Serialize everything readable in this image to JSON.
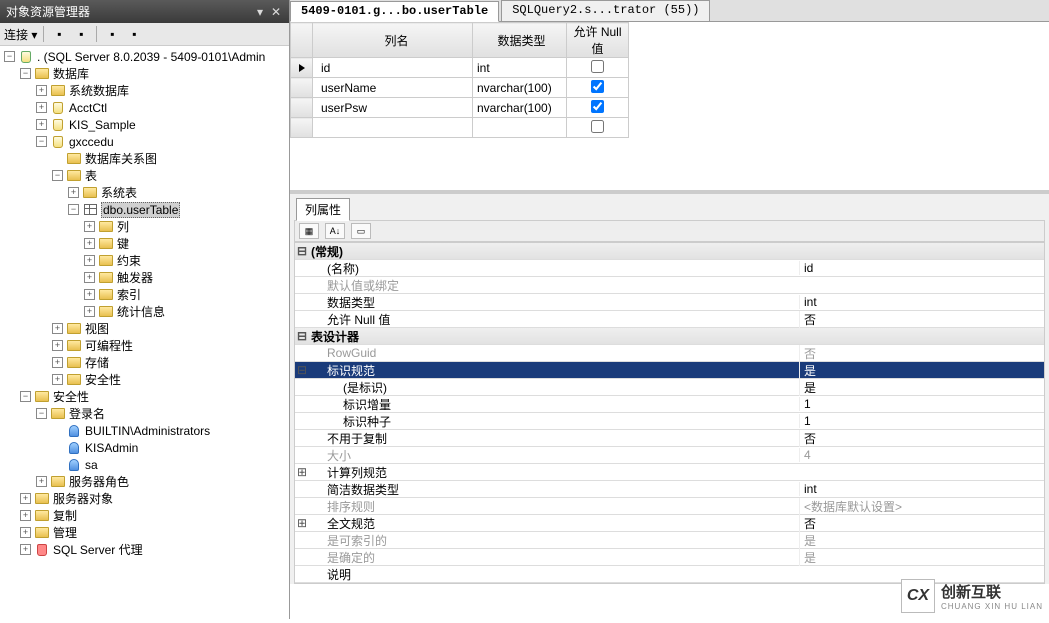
{
  "panel": {
    "title": "对象资源管理器",
    "connect_label": "连接"
  },
  "tree": {
    "root": ". (SQL Server 8.0.2039 - 5409-0101\\Admin",
    "n_database": "数据库",
    "n_sysdb": "系统数据库",
    "n_acctctl": "AcctCtl",
    "n_kissample": "KIS_Sample",
    "n_gxccedu": "gxccedu",
    "n_dbdiagram": "数据库关系图",
    "n_tables": "表",
    "n_systables": "系统表",
    "n_usertable": "dbo.userTable",
    "n_columns": "列",
    "n_keys": "键",
    "n_constraints": "约束",
    "n_triggers": "触发器",
    "n_indexes": "索引",
    "n_stats": "统计信息",
    "n_views": "视图",
    "n_prog": "可编程性",
    "n_storage": "存储",
    "n_security_db": "安全性",
    "n_security": "安全性",
    "n_logins": "登录名",
    "n_login_builtin": "BUILTIN\\Administrators",
    "n_login_kis": "KISAdmin",
    "n_login_sa": "sa",
    "n_serverroles": "服务器角色",
    "n_serverobj": "服务器对象",
    "n_replication": "复制",
    "n_management": "管理",
    "n_agent": "SQL Server 代理"
  },
  "tabs": [
    {
      "label": "5409-0101.g...bo.userTable",
      "active": true
    },
    {
      "label": "SQLQuery2.s...trator (55))",
      "active": false
    }
  ],
  "grid": {
    "headers": {
      "name": "列名",
      "type": "数据类型",
      "allownull": "允许 Null 值"
    },
    "rows": [
      {
        "name": "id",
        "type": "int",
        "allownull": false,
        "selected": true
      },
      {
        "name": "userName",
        "type": "nvarchar(100)",
        "allownull": true
      },
      {
        "name": "userPsw",
        "type": "nvarchar(100)",
        "allownull": true
      },
      {
        "name": "",
        "type": "",
        "allownull": false
      }
    ]
  },
  "prop": {
    "tab": "列属性",
    "sort_btn1": "▦",
    "sort_btn2": "A↓",
    "rows": [
      {
        "kind": "header",
        "exp": "⊟",
        "name": "(常规)",
        "val": ""
      },
      {
        "kind": "row",
        "indent": 1,
        "name": "(名称)",
        "val": "id"
      },
      {
        "kind": "disabled",
        "indent": 1,
        "name": "默认值或绑定",
        "val": ""
      },
      {
        "kind": "row",
        "indent": 1,
        "name": "数据类型",
        "val": "int"
      },
      {
        "kind": "row",
        "indent": 1,
        "name": "允许 Null 值",
        "val": "否"
      },
      {
        "kind": "header",
        "exp": "⊟",
        "name": "表设计器",
        "val": ""
      },
      {
        "kind": "disabled",
        "indent": 1,
        "name": "RowGuid",
        "val": "否"
      },
      {
        "kind": "selected",
        "exp": "⊟",
        "indent": 1,
        "name": "标识规范",
        "val": "是"
      },
      {
        "kind": "row",
        "indent": 2,
        "name": "(是标识)",
        "val": "是"
      },
      {
        "kind": "row",
        "indent": 2,
        "name": "标识增量",
        "val": "1"
      },
      {
        "kind": "row",
        "indent": 2,
        "name": "标识种子",
        "val": "1"
      },
      {
        "kind": "row",
        "indent": 1,
        "name": "不用于复制",
        "val": "否"
      },
      {
        "kind": "disabled",
        "indent": 1,
        "name": "大小",
        "val": "4"
      },
      {
        "kind": "row",
        "exp": "⊞",
        "indent": 1,
        "name": "计算列规范",
        "val": ""
      },
      {
        "kind": "row",
        "indent": 1,
        "name": "简洁数据类型",
        "val": "int"
      },
      {
        "kind": "disabled",
        "indent": 1,
        "name": "排序规则",
        "val": "<数据库默认设置>"
      },
      {
        "kind": "row",
        "exp": "⊞",
        "indent": 1,
        "name": "全文规范",
        "val": "否"
      },
      {
        "kind": "disabled",
        "indent": 1,
        "name": "是可索引的",
        "val": "是"
      },
      {
        "kind": "disabled",
        "indent": 1,
        "name": "是确定的",
        "val": "是"
      },
      {
        "kind": "row",
        "indent": 1,
        "name": "说明",
        "val": ""
      }
    ]
  },
  "watermark": {
    "logo": "CX",
    "zh": "创新互联",
    "en": "CHUANG XIN HU LIAN"
  }
}
